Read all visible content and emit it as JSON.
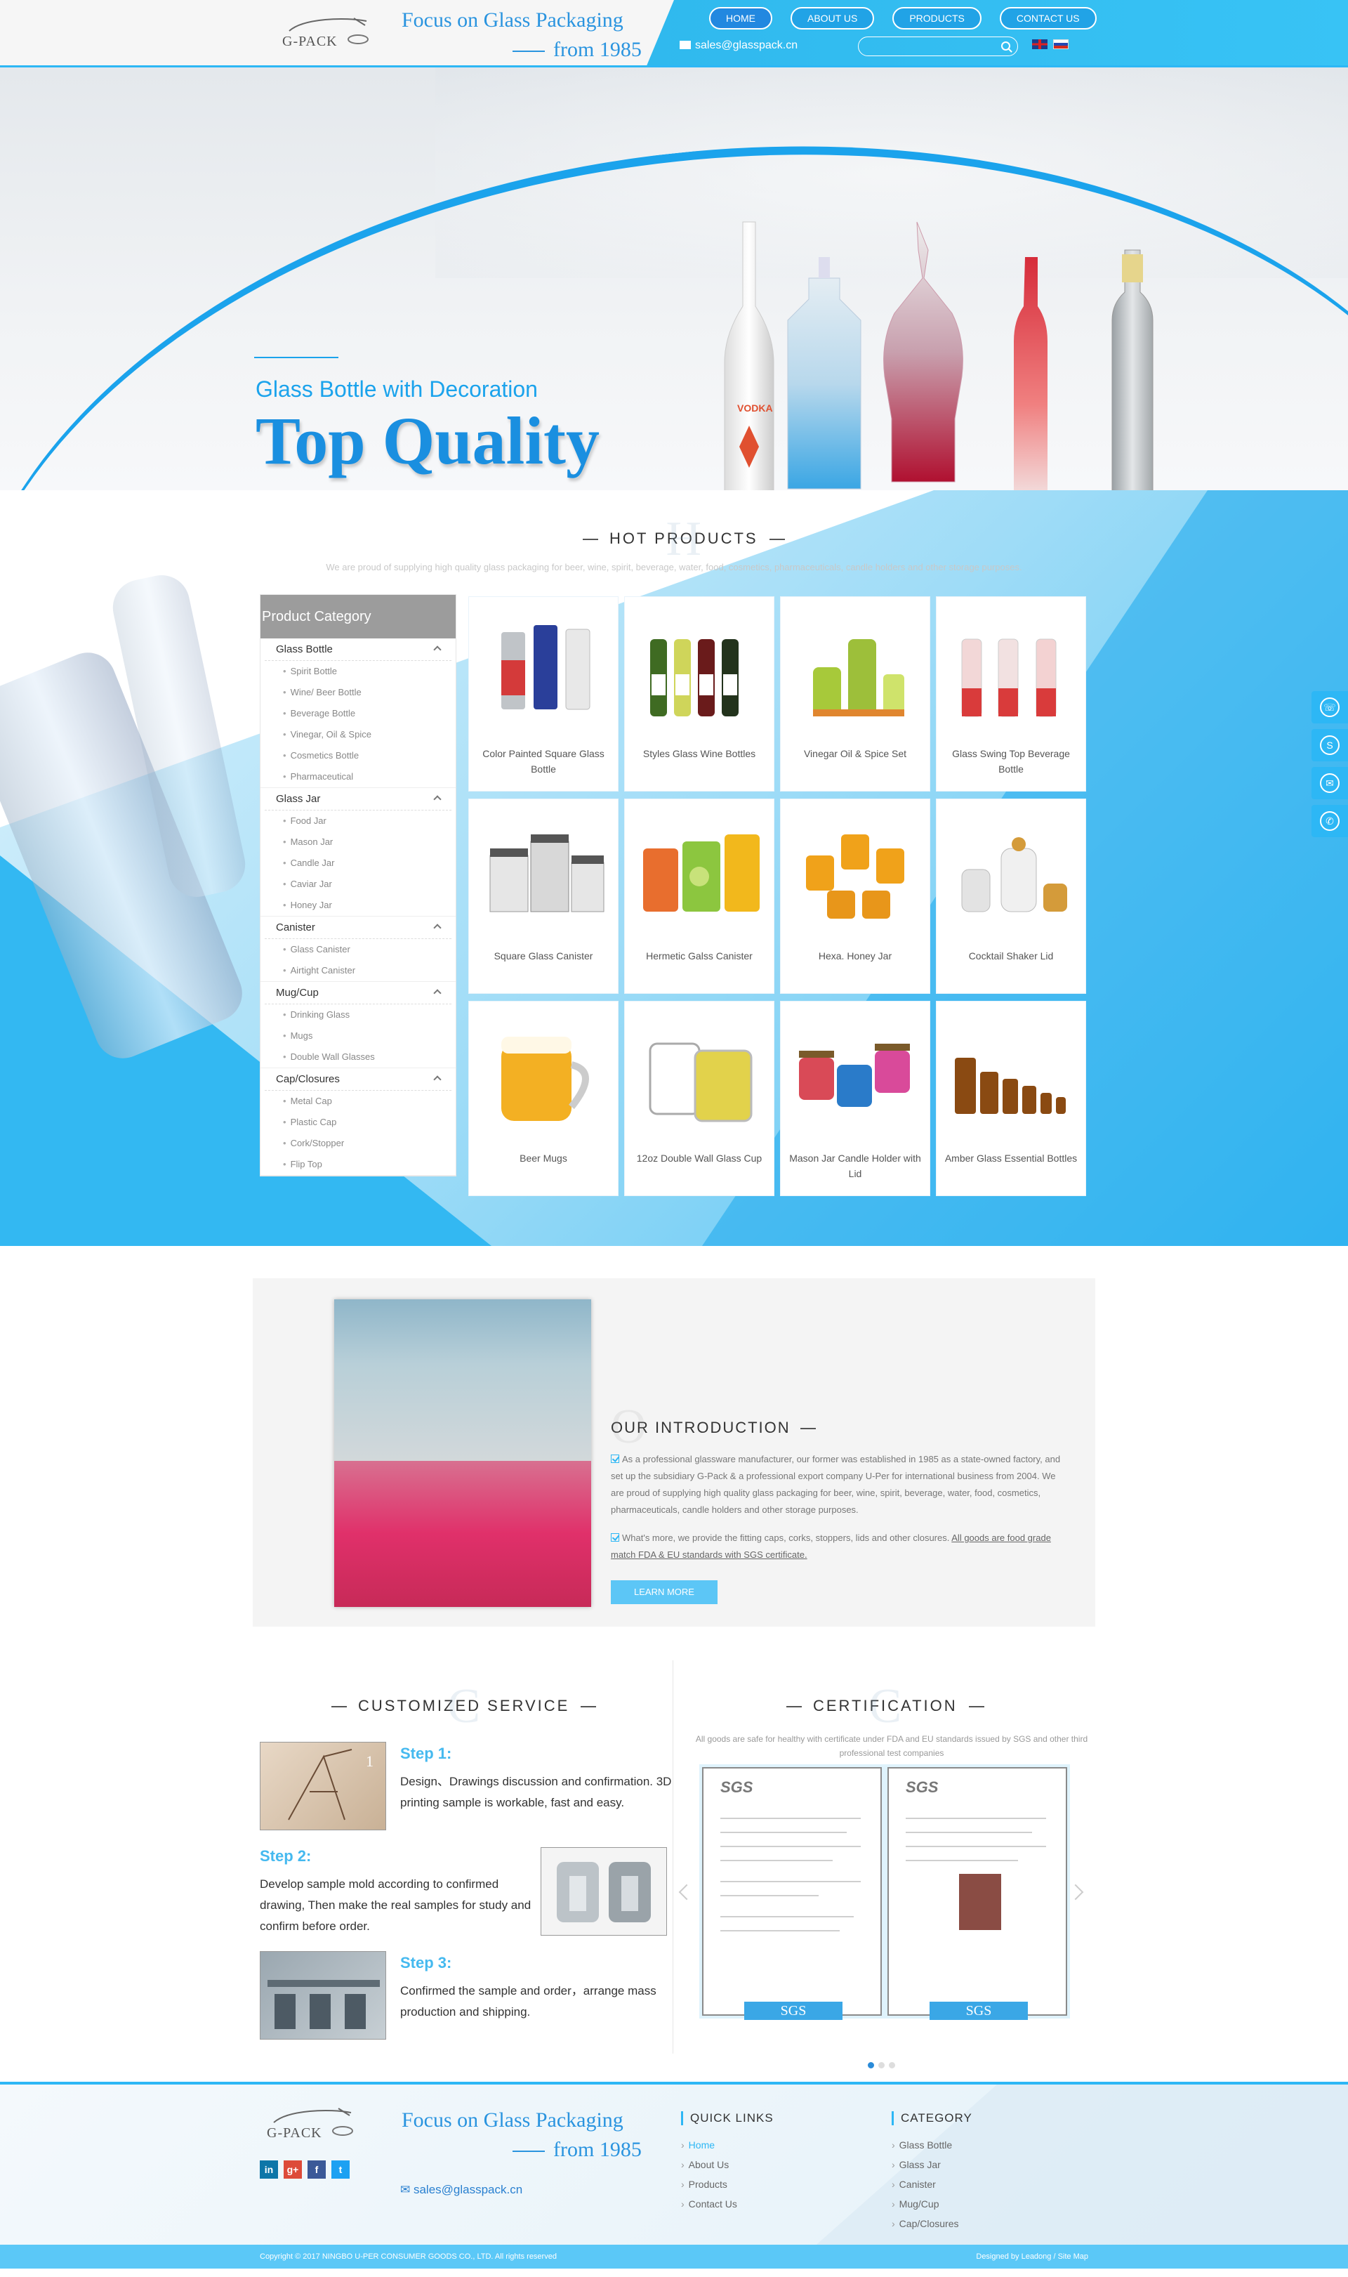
{
  "header": {
    "logo_text": "G-PACK",
    "slogan_line1": "Focus on Glass Packaging",
    "slogan_line2": "from 1985",
    "nav": [
      "HOME",
      "ABOUT US",
      "PRODUCTS",
      "CONTACT US"
    ],
    "email": "sales@glasspack.cn",
    "search_placeholder": "",
    "languages": [
      "English",
      "Russian"
    ]
  },
  "banner": {
    "subtitle": "Glass Bottle with Decoration",
    "title": "Top Quality",
    "bottle_label": "VODKA",
    "slides": 6,
    "active_slide": 1
  },
  "hot_products": {
    "title": "HOT PRODUCTS",
    "ghost_letter": "H",
    "description": "We are proud of supplying high quality glass packaging for beer, wine, spirit, beverage, water, food, cosmetics, pharmaceuticals, candle holders and other storage purposes.",
    "category_title": "Product Category",
    "categories": [
      {
        "name": "Glass Bottle",
        "items": [
          "Spirit Bottle",
          "Wine/ Beer Bottle",
          "Beverage Bottle",
          "Vinegar, Oil & Spice",
          "Cosmetics Bottle",
          "Pharmaceutical"
        ]
      },
      {
        "name": "Glass Jar",
        "items": [
          "Food Jar",
          "Mason Jar",
          "Candle Jar",
          "Caviar Jar",
          "Honey Jar"
        ]
      },
      {
        "name": "Canister",
        "items": [
          "Glass Canister",
          "Airtight Canister"
        ]
      },
      {
        "name": "Mug/Cup",
        "items": [
          "Drinking Glass",
          "Mugs",
          "Double Wall Glasses"
        ]
      },
      {
        "name": "Cap/Closures",
        "items": [
          "Metal Cap",
          "Plastic Cap",
          "Cork/Stopper",
          "Flip Top"
        ]
      }
    ],
    "products": [
      "Color Painted Square Glass Bottle",
      "Styles Glass Wine Bottles",
      "Vinegar Oil & Spice Set",
      "Glass Swing Top Beverage Bottle",
      "Square Glass Canister",
      "Hermetic Galss Canister",
      "Hexa. Honey Jar",
      "Cocktail Shaker Lid",
      "Beer Mugs",
      "12oz Double Wall Glass Cup",
      "Mason Jar Candle Holder with Lid",
      "Amber Glass Essential Bottles"
    ]
  },
  "side_tools": [
    "phone-icon",
    "skype-icon",
    "mail-icon",
    "whatsapp-icon"
  ],
  "introduction": {
    "title": "OUR INTRODUCTION",
    "ghost_letter": "O",
    "para1": "As a professional glassware manufacturer, our former was established in 1985 as a state-owned factory, and set up the subsidiary G-Pack & a professional export company U-Per for international business from 2004. We are proud of supplying high quality glass packaging for beer, wine, spirit, beverage, water, food, cosmetics, pharmaceuticals, candle holders and other storage purposes.",
    "para2_plain": "What's more, we provide the fitting caps, corks, stoppers, lids and other closures. ",
    "para2_underlined": "All goods are food grade match FDA & EU standards with SGS certificate.",
    "button": "LEARN MORE"
  },
  "service": {
    "title": "CUSTOMIZED SERVICE",
    "ghost_letter": "C",
    "steps": [
      {
        "heading": "Step 1:",
        "text": "Design、Drawings discussion and confirmation. 3D printing sample is workable, fast and easy.",
        "badge": "1"
      },
      {
        "heading": "Step 2:",
        "text": "Develop sample mold according to confirmed drawing, Then make the real samples for study and confirm before order."
      },
      {
        "heading": "Step 3:",
        "text": "Confirmed the sample and order，arrange mass production and shipping."
      }
    ]
  },
  "certification": {
    "title": "CERTIFICATION",
    "ghost_letter": "C",
    "description": "All goods are safe for healthy with certificate under FDA and EU standards issued by SGS and other third professional test companies",
    "cards": [
      {
        "logo": "SGS",
        "ribbon": "SGS"
      },
      {
        "logo": "SGS",
        "ribbon": "SGS"
      }
    ],
    "dots": 3,
    "active_dot": 1
  },
  "footer": {
    "logo_text": "G-PACK",
    "slogan_line1": "Focus on Glass Packaging",
    "slogan_line2": "from 1985",
    "social": [
      "in",
      "g+",
      "f",
      "t"
    ],
    "email": "sales@glasspack.cn",
    "quick_links_title": "QUICK LINKS",
    "quick_links": [
      "Home",
      "About Us",
      "Products",
      "Contact Us"
    ],
    "category_title": "CATEGORY",
    "categories": [
      "Glass Bottle",
      "Glass Jar",
      "Canister",
      "Mug/Cup",
      "Cap/Closures"
    ],
    "copyright": "Copyright © 2017 NINGBO U-PER CONSUMER GOODS CO., LTD. All rights reserved",
    "credits": "Designed by Leadong",
    "sitemap": "Site Map"
  },
  "colors": {
    "accent": "#2db7f5",
    "brand_blue": "#2a94df",
    "category_header": "#9c9c9c"
  }
}
